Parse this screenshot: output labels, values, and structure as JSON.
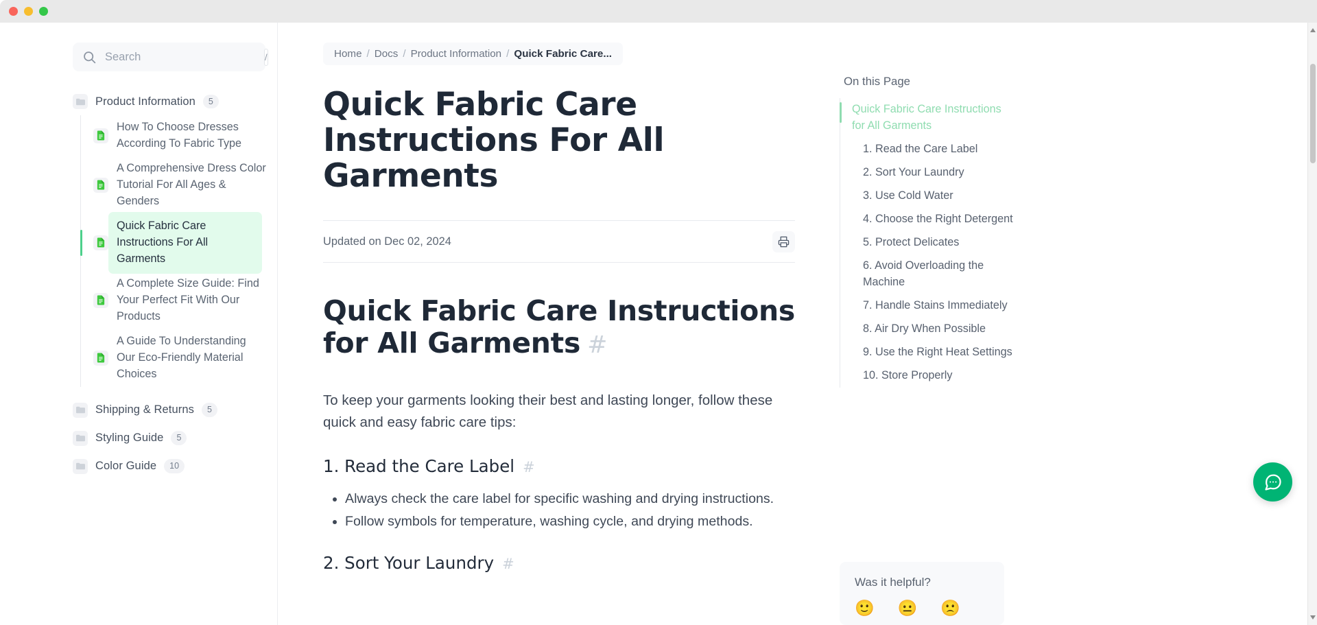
{
  "window": {
    "traffic_lights": [
      "close",
      "minimize",
      "maximize"
    ]
  },
  "sidebar": {
    "search": {
      "placeholder": "Search",
      "value": "",
      "shortcut_key": "/"
    },
    "tree": [
      {
        "type": "folder",
        "label": "Product Information",
        "count": "5",
        "expanded": true,
        "children": [
          {
            "label": "How To Choose Dresses According To Fabric Type",
            "active": false
          },
          {
            "label": "A Comprehensive Dress Color Tutorial For All Ages & Genders",
            "active": false
          },
          {
            "label": "Quick Fabric Care Instructions For All Garments",
            "active": true
          },
          {
            "label": "A Complete Size Guide: Find Your Perfect Fit With Our Products",
            "active": false
          },
          {
            "label": "A Guide To Understanding Our Eco-Friendly Material Choices",
            "active": false
          }
        ]
      },
      {
        "type": "folder",
        "label": "Shipping & Returns",
        "count": "5",
        "expanded": false,
        "children": []
      },
      {
        "type": "folder",
        "label": "Styling Guide",
        "count": "5",
        "expanded": false,
        "children": []
      },
      {
        "type": "folder",
        "label": "Color Guide",
        "count": "10",
        "expanded": false,
        "children": []
      }
    ]
  },
  "breadcrumb": {
    "items": [
      "Home",
      "Docs",
      "Product Information"
    ],
    "separator": "/",
    "current": "Quick Fabric Care..."
  },
  "article": {
    "title": "Quick Fabric Care Instructions For All Garments",
    "updated": "Updated on Dec 02, 2024",
    "print_label": "print-icon",
    "heading": "Quick Fabric Care Instructions for All Garments",
    "anchor": "#",
    "intro": "To keep your garments looking their best and lasting longer, follow these quick and easy fabric care tips:",
    "sections": [
      {
        "title": "1. Read the Care Label",
        "anchor": "#",
        "bullets": [
          "Always check the care label for specific washing and drying instructions.",
          "Follow symbols for temperature, washing cycle, and drying methods."
        ]
      },
      {
        "title": "2. Sort Your Laundry",
        "anchor": "#",
        "bullets": []
      }
    ]
  },
  "toc": {
    "heading": "On this Page",
    "items": [
      {
        "label": "Quick Fabric Care Instructions for All Garments",
        "level": 1,
        "active": true
      },
      {
        "label": "1. Read the Care Label",
        "level": 2,
        "active": false
      },
      {
        "label": "2. Sort Your Laundry",
        "level": 2,
        "active": false
      },
      {
        "label": "3. Use Cold Water",
        "level": 2,
        "active": false
      },
      {
        "label": "4. Choose the Right Detergent",
        "level": 2,
        "active": false
      },
      {
        "label": "5. Protect Delicates",
        "level": 2,
        "active": false
      },
      {
        "label": "6. Avoid Overloading the Machine",
        "level": 2,
        "active": false
      },
      {
        "label": "7. Handle Stains Immediately",
        "level": 2,
        "active": false
      },
      {
        "label": "8. Air Dry When Possible",
        "level": 2,
        "active": false
      },
      {
        "label": "9. Use the Right Heat Settings",
        "level": 2,
        "active": false
      },
      {
        "label": "10. Store Properly",
        "level": 2,
        "active": false
      }
    ]
  },
  "feedback": {
    "title": "Was it helpful?",
    "emojis": [
      "🙂",
      "😐",
      "🙁"
    ]
  },
  "chat": {
    "label": "chat-bubble-icon"
  },
  "colors": {
    "accent_green": "#00b474",
    "active_bg": "#e2fbec",
    "active_bar": "#4dd08b",
    "toc_active": "#8fdcb0",
    "doc_icon_green": "#3ec93e"
  }
}
